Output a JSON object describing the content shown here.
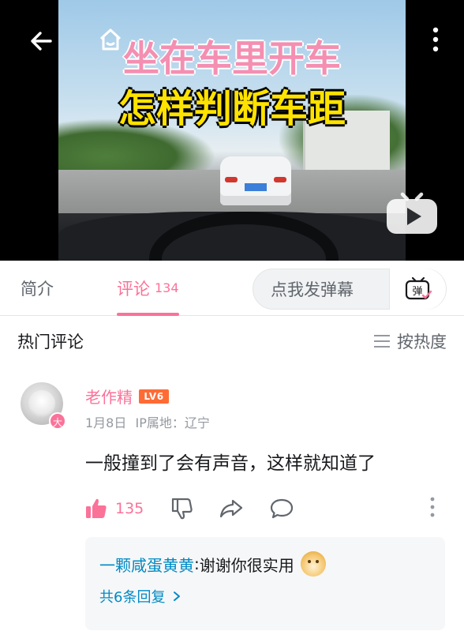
{
  "video": {
    "title_line1": "坐在车里开车",
    "title_line2": "怎样判断车距",
    "icons": [
      "back-arrow-icon",
      "home-icon",
      "more-vertical-icon",
      "tv-play-icon"
    ]
  },
  "tabs": {
    "intro_label": "简介",
    "comments_label": "评论",
    "comments_count": "134",
    "danmaku_placeholder": "点我发弹幕",
    "danmaku_icon_label": "弹"
  },
  "hot": {
    "title": "热门评论",
    "sort_label": "按热度"
  },
  "comment": {
    "username": "老作精",
    "level": "LV6",
    "avatar_badge": "大",
    "date": "1月8日",
    "ip_location": "IP属地：辽宁",
    "text": "一般撞到了会有声音，这样就知道了",
    "like_count": "135",
    "reply": {
      "user": "一颗咸蛋黄黄",
      "separator": ":",
      "text": " 谢谢你很实用",
      "more": "共6条回复"
    }
  },
  "colors": {
    "accent": "#fb7299",
    "link": "#008ac5",
    "level_badge": "#ff6b35"
  }
}
